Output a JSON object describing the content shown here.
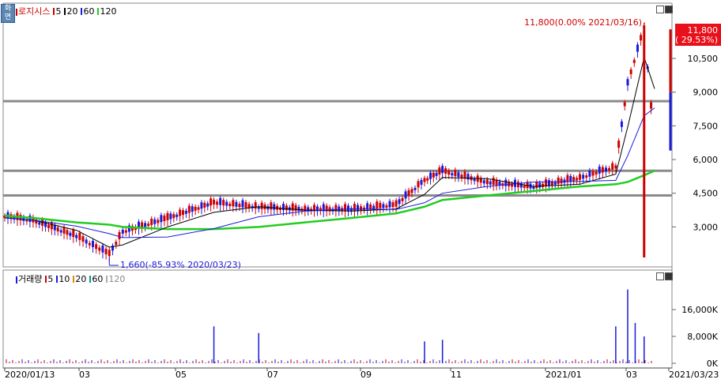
{
  "app": {
    "corner_label": "화면"
  },
  "price_panel": {
    "legend": [
      {
        "label": "로지시스",
        "color": "#cc0000",
        "swatch": "#cc0000"
      },
      {
        "label": "5",
        "color": "#000000",
        "swatch": "#cc0000"
      },
      {
        "label": "20",
        "color": "#000000",
        "swatch": "#000000"
      },
      {
        "label": "60",
        "color": "#000000",
        "swatch": "#1a1adb"
      },
      {
        "label": "120",
        "color": "#000000",
        "swatch": "#22cc22"
      }
    ],
    "current_price_box": {
      "line1": "11,800",
      "line2": "( 29.53%)",
      "color": "#e8101a"
    },
    "high_annotation": "11,800(0.00% 2021/03/16)",
    "low_annotation": "1,660(-85.93% 2020/03/23)",
    "y_ticks": [
      "10,500",
      "9,000",
      "7,500",
      "6,000",
      "4,500",
      "3,000"
    ]
  },
  "volume_panel": {
    "legend": [
      {
        "label": "거래량",
        "color": "#000000",
        "swatch": "#1a1adb"
      },
      {
        "label": "5",
        "color": "#000000",
        "swatch": "#cc0000"
      },
      {
        "label": "10",
        "color": "#000000",
        "swatch": "#1a1adb"
      },
      {
        "label": "20",
        "color": "#000000",
        "swatch": "#e08a00"
      },
      {
        "label": "60",
        "color": "#000000",
        "swatch": "#009a8a"
      },
      {
        "label": "120",
        "color": "#888888",
        "swatch": "#aaaaaa"
      }
    ],
    "y_ticks": [
      "16,000K",
      "8,000K",
      "0K"
    ]
  },
  "x_axis": {
    "labels": [
      "2020/01/13",
      "03",
      "05",
      "07",
      "09",
      "11",
      "2021/01",
      "03",
      "2021/03/23"
    ]
  },
  "chart_data": [
    {
      "type": "candlestick",
      "title": "로지시스",
      "x_range": [
        "2020/01/13",
        "2021/03/23"
      ],
      "ylim": [
        1500,
        12400
      ],
      "grid": false,
      "legend": "top-left",
      "series": [
        {
          "name": "5",
          "color": "#cc0000"
        },
        {
          "name": "20",
          "color": "#000000"
        },
        {
          "name": "60",
          "color": "#1a1adb"
        },
        {
          "name": "120",
          "color": "#22cc22"
        }
      ],
      "x": [
        "2020/01/13",
        "2020/02",
        "2020/03",
        "2020/03/23",
        "2020/04",
        "2020/05",
        "2020/06",
        "2020/07",
        "2020/08",
        "2020/09",
        "2020/10",
        "2020/10/20",
        "2020/11",
        "2020/12",
        "2021/01",
        "2021/02",
        "2021/02/25",
        "2021/03/05",
        "2021/03/16",
        "2021/03/23"
      ],
      "close": [
        3400,
        3200,
        2500,
        1700,
        2700,
        3300,
        4000,
        3800,
        3700,
        3700,
        3900,
        5000,
        5400,
        4900,
        4700,
        5100,
        5600,
        9300,
        11800,
        6500
      ],
      "ma120": [
        3500,
        3400,
        3200,
        3100,
        3000,
        2900,
        2900,
        3000,
        3200,
        3400,
        3600,
        3900,
        4200,
        4400,
        4600,
        4800,
        4900,
        5000,
        5300,
        5500
      ],
      "horizontal_lines": [
        8600,
        5500,
        4400
      ],
      "high_label": {
        "value": 11800,
        "date": "2021/03/16",
        "pct": 0.0
      },
      "low_label": {
        "value": 1660,
        "date": "2020/03/23",
        "pct": -85.93
      }
    },
    {
      "type": "bar",
      "title": "거래량",
      "ylim": [
        0,
        24000
      ],
      "unit": "K",
      "x": [
        "2020/06",
        "2020/07",
        "2020/10/20",
        "2020/11",
        "2021/02/25",
        "2021/03/05",
        "2021/03/10",
        "2021/03/16"
      ],
      "values": [
        11000,
        9000,
        6500,
        7000,
        11000,
        22000,
        12000,
        8000
      ]
    }
  ]
}
